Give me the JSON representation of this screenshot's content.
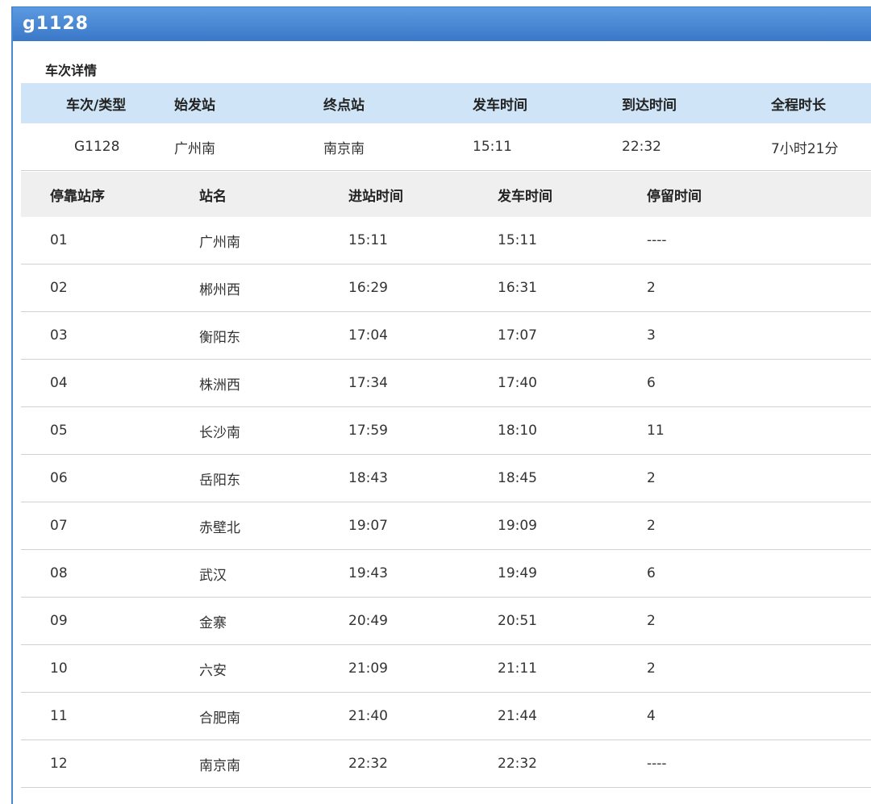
{
  "window": {
    "title": "g1128"
  },
  "section": {
    "title": "车次详情"
  },
  "summary": {
    "headers": [
      "车次/类型",
      "始发站",
      "终点站",
      "发车时间",
      "到达时间",
      "全程时长"
    ],
    "row": [
      "G1128",
      "广州南",
      "南京南",
      "15:11",
      "22:32",
      "7小时21分"
    ]
  },
  "stops": {
    "headers": [
      "停靠站序",
      "站名",
      "进站时间",
      "发车时间",
      "停留时间"
    ],
    "rows": [
      [
        "01",
        "广州南",
        "15:11",
        "15:11",
        "----"
      ],
      [
        "02",
        "郴州西",
        "16:29",
        "16:31",
        "2"
      ],
      [
        "03",
        "衡阳东",
        "17:04",
        "17:07",
        "3"
      ],
      [
        "04",
        "株洲西",
        "17:34",
        "17:40",
        "6"
      ],
      [
        "05",
        "长沙南",
        "17:59",
        "18:10",
        "11"
      ],
      [
        "06",
        "岳阳东",
        "18:43",
        "18:45",
        "2"
      ],
      [
        "07",
        "赤壁北",
        "19:07",
        "19:09",
        "2"
      ],
      [
        "08",
        "武汉",
        "19:43",
        "19:49",
        "6"
      ],
      [
        "09",
        "金寨",
        "20:49",
        "20:51",
        "2"
      ],
      [
        "10",
        "六安",
        "21:09",
        "21:11",
        "2"
      ],
      [
        "11",
        "合肥南",
        "21:40",
        "21:44",
        "4"
      ],
      [
        "12",
        "南京南",
        "22:32",
        "22:32",
        "----"
      ]
    ]
  },
  "colors": {
    "titlebar": "#4a88d0",
    "summary_header_bg": "#cfe5f7",
    "stops_header_bg": "#efefef"
  }
}
